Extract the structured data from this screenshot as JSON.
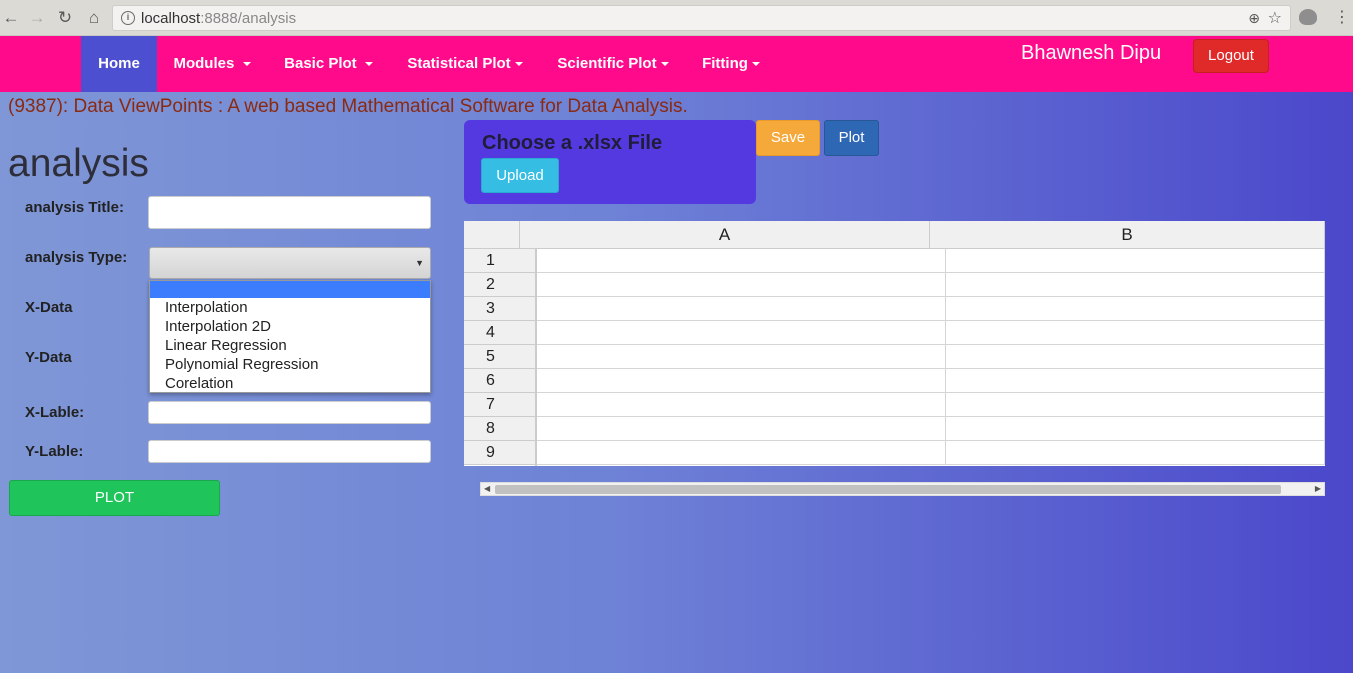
{
  "browser": {
    "url_host": "localhost",
    "url_port_path": ":8888/analysis"
  },
  "navbar": {
    "items": [
      {
        "label": "Home"
      },
      {
        "label": "Modules"
      },
      {
        "label": "Basic Plot"
      },
      {
        "label": "Statistical Plot"
      },
      {
        "label": "Scientific Plot"
      },
      {
        "label": "Fitting"
      }
    ],
    "username": "Bhawnesh Dipu",
    "logout_label": "Logout"
  },
  "app_title": "(9387): Data ViewPoints : A web based Mathematical Software for Data Analysis.",
  "form": {
    "heading": "analysis",
    "title_label": "analysis Title:",
    "title_value": "",
    "type_label": "analysis Type:",
    "type_selected": "",
    "type_options": [
      "",
      "Interpolation",
      "Interpolation 2D",
      "Linear Regression",
      "Polynomial Regression",
      "Corelation"
    ],
    "xdata_label": "X-Data",
    "ydata_label": "Y-Data",
    "xlabel_label": "X-Lable:",
    "xlabel_value": "",
    "ylabel_label": "Y-Lable:",
    "ylabel_value": "",
    "plot_label": "PLOT"
  },
  "file": {
    "choose_label": "Choose a .xlsx File",
    "upload_label": "Upload",
    "save_label": "Save",
    "plot_label": "Plot"
  },
  "sheet": {
    "columns": [
      "A",
      "B"
    ],
    "rows": [
      "1",
      "2",
      "3",
      "4",
      "5",
      "6",
      "7",
      "8",
      "9"
    ]
  }
}
